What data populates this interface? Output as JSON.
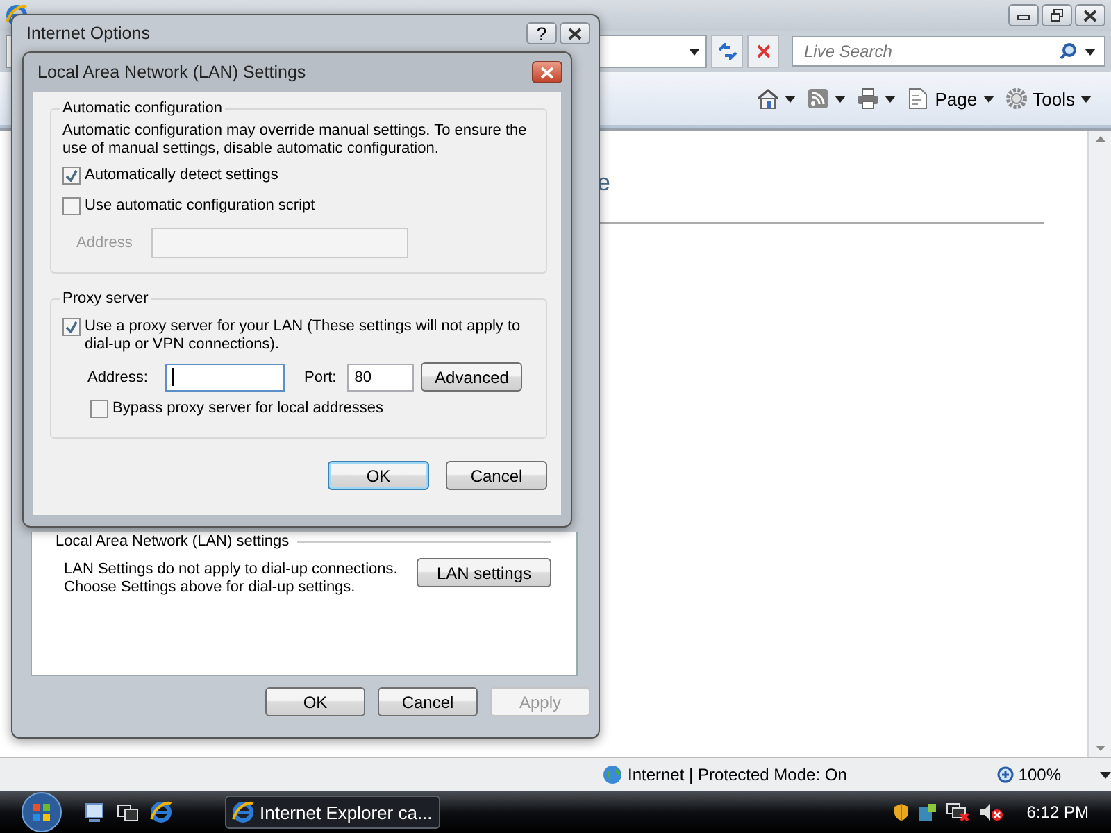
{
  "browser": {
    "search_placeholder": "Live Search",
    "toolbar": [
      {
        "kind": "home"
      },
      {
        "kind": "feed"
      },
      {
        "kind": "print"
      },
      {
        "kind": "page",
        "label": "Page"
      },
      {
        "kind": "tools",
        "label": "Tools"
      }
    ],
    "content_fragment": "e",
    "status": "Internet | Protected Mode: On",
    "zoom": "100%"
  },
  "options_dialog": {
    "title": "Internet Options",
    "help": "?",
    "lan_group": "Local Area Network (LAN) settings",
    "lan_note": [
      "LAN Settings do not apply to dial-up connections.",
      "Choose Settings above for dial-up settings."
    ],
    "lan_button": "LAN settings",
    "buttons": [
      {
        "label": "OK",
        "disabled": false
      },
      {
        "label": "Cancel",
        "disabled": false
      },
      {
        "label": "Apply",
        "disabled": true
      }
    ]
  },
  "lan_dialog": {
    "title": "Local Area Network (LAN) Settings",
    "auto": {
      "legend": "Automatic configuration",
      "note": "Automatic configuration may override manual settings.  To ensure the use of manual settings, disable automatic configuration.",
      "options": [
        {
          "label": "Automatically detect settings",
          "checked": true
        },
        {
          "label": "Use automatic configuration script",
          "checked": false
        }
      ],
      "address": {
        "label": "Address",
        "disabled": true
      }
    },
    "proxy": {
      "legend": "Proxy server",
      "use": {
        "label": "Use a proxy server for your LAN (These settings will not apply to dial-up or VPN connections).",
        "checked": true
      },
      "address": {
        "label": "Address:",
        "focused": true
      },
      "port": {
        "label": "Port:",
        "value": "80"
      },
      "advanced": "Advanced",
      "bypass": {
        "label": "Bypass proxy server for local addresses",
        "checked": false
      }
    },
    "buttons": [
      {
        "label": "OK",
        "default": true
      },
      {
        "label": "Cancel",
        "default": false
      }
    ]
  },
  "taskbar": {
    "task": "Internet Explorer ca...",
    "clock": "6:12 PM"
  }
}
